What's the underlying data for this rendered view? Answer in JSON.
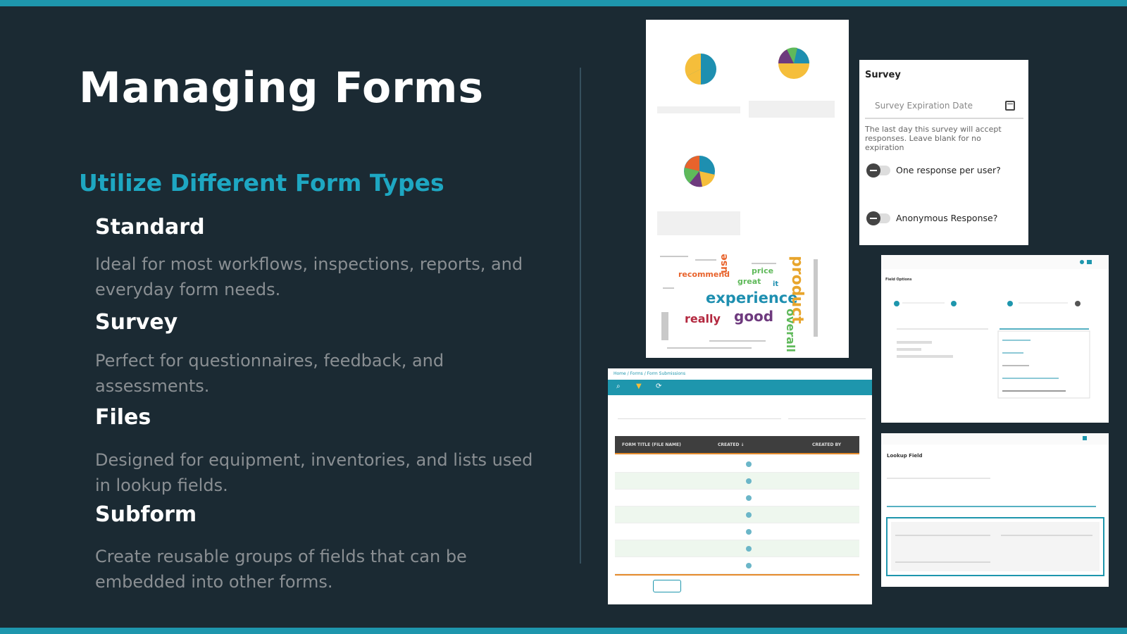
{
  "slide": {
    "title": "Managing Forms",
    "subtitle": "Utilize Different Form Types",
    "types": [
      {
        "name": "Standard",
        "description": "Ideal for most workflows, inspections, reports, and everyday form needs."
      },
      {
        "name": "Survey",
        "description": "Perfect for questionnaires, feedback, and assessments."
      },
      {
        "name": "Files",
        "description": "Designed for equipment, inventories, and lists used in lookup fields."
      },
      {
        "name": "Subform",
        "description": "Create reusable groups of fields that can be embedded into other forms."
      }
    ]
  },
  "colors": {
    "background": "#1b2a33",
    "accent": "#1e96ad",
    "heading": "#ffffff",
    "subtitle": "#1ea7c2",
    "body_text": "#8a8f93"
  },
  "survey_card": {
    "title": "Survey",
    "expiration_placeholder": "Survey Expiration Date",
    "calendar_icon": "calendar-icon",
    "help_text": "The last day this survey will accept responses. Leave blank for no expiration",
    "toggles": [
      {
        "label": "One response per user?"
      },
      {
        "label": "Anonymous Response?"
      }
    ]
  },
  "report_thumbnail": {
    "word_cloud": [
      "experience",
      "product",
      "really",
      "good",
      "overall",
      "recommend",
      "use",
      "price",
      "great",
      "it"
    ]
  },
  "submissions_thumbnail": {
    "breadcrumb": "Home / Forms / Form Submissions",
    "columns": [
      "FORM TITLE (FILE NAME)",
      "CREATED ↓",
      "CREATED BY"
    ],
    "rows": 7
  },
  "field_options_thumbnail": {
    "title": "Field Options"
  },
  "lookup_thumbnail": {
    "title": "Lookup Field"
  }
}
